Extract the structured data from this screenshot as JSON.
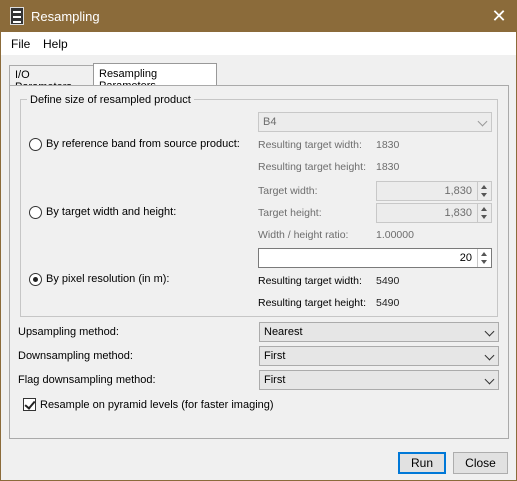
{
  "window": {
    "title": "Resampling"
  },
  "menu": {
    "file": "File",
    "help": "Help"
  },
  "tabs": [
    {
      "label": "I/O Parameters"
    },
    {
      "label": "Resampling Parameters"
    }
  ],
  "group": {
    "title": "Define size of resampled product",
    "by_ref": {
      "label": "By reference band from source product:",
      "band_value": "B4",
      "width_label": "Resulting target width:",
      "width_value": "1830",
      "height_label": "Resulting target height:",
      "height_value": "1830"
    },
    "by_size": {
      "label": "By target width and height:",
      "width_label": "Target width:",
      "width_value": "1,830",
      "height_label": "Target height:",
      "height_value": "1,830",
      "ratio_label": "Width / height ratio:",
      "ratio_value": "1.00000"
    },
    "by_res": {
      "label": "By pixel resolution (in m):",
      "resolution_value": "20",
      "width_label": "Resulting target width:",
      "width_value": "5490",
      "height_label": "Resulting target height:",
      "height_value": "5490"
    }
  },
  "methods": {
    "upsampling_label": "Upsampling method:",
    "upsampling_value": "Nearest",
    "downsampling_label": "Downsampling method:",
    "downsampling_value": "First",
    "flag_label": "Flag downsampling method:",
    "flag_value": "First"
  },
  "pyramid": {
    "label": "Resample on pyramid levels (for faster imaging)",
    "checked": true
  },
  "buttons": {
    "run": "Run",
    "close": "Close"
  }
}
